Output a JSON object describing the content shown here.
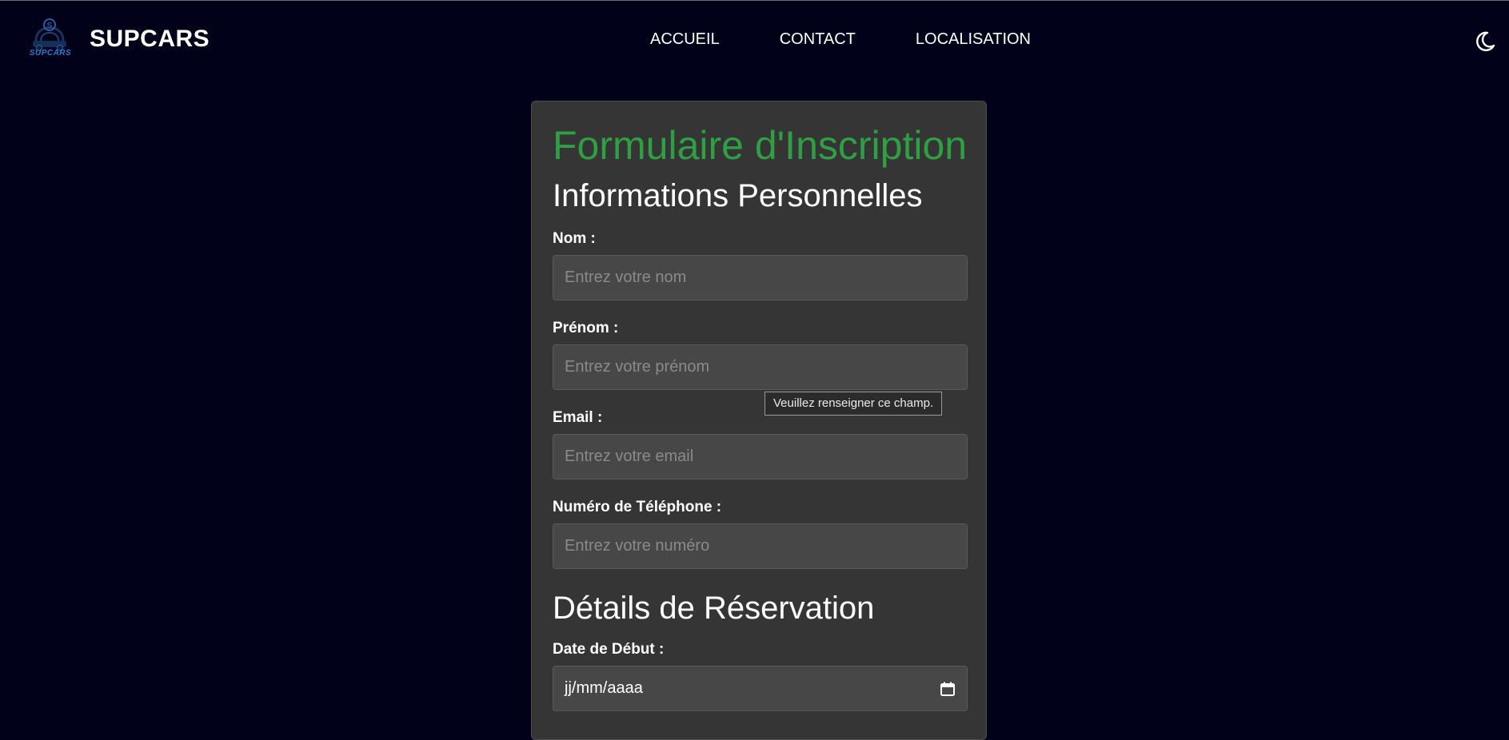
{
  "brand": {
    "logo_text": "SUPCARS",
    "name": "SUPCARS"
  },
  "nav": {
    "items": [
      "ACCUEIL",
      "CONTACT",
      "LOCALISATION"
    ]
  },
  "theme_toggle": {
    "icon": "moon-icon"
  },
  "form": {
    "title": "Formulaire d'Inscription",
    "section_personal": "Informations Personnelles",
    "nom_label": "Nom :",
    "nom_placeholder": "Entrez votre nom",
    "prenom_label": "Prénom :",
    "prenom_placeholder": "Entrez votre prénom",
    "email_label": "Email :",
    "email_placeholder": "Entrez votre email",
    "phone_label": "Numéro de Téléphone :",
    "phone_placeholder": "Entrez votre numéro",
    "section_reservation": "Détails de Réservation",
    "start_date_label": "Date de Début :",
    "start_date_value": "jj/mm/aaaa"
  },
  "tooltip": {
    "text": "Veuillez renseigner ce champ."
  },
  "colors": {
    "background": "#02011a",
    "card": "#353535",
    "accent_green": "#2ea043",
    "logo_blue": "#2a7fd1"
  }
}
